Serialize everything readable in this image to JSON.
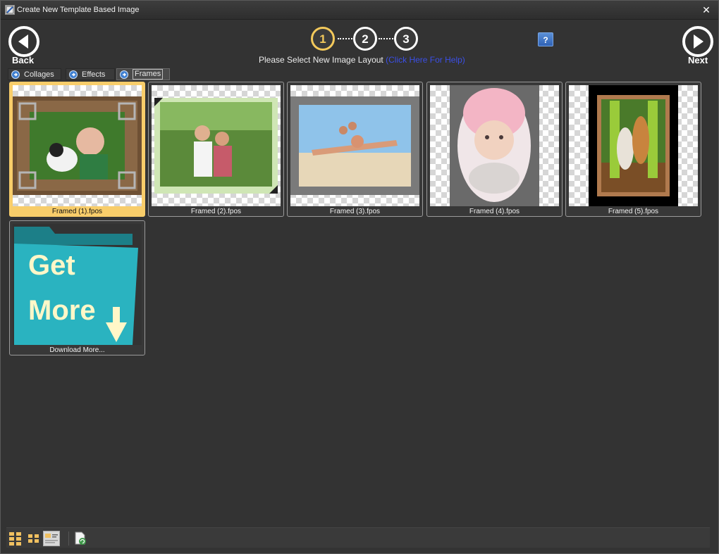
{
  "window": {
    "title": "Create New Template Based Image",
    "close_glyph": "✕"
  },
  "nav": {
    "back_label": "Back",
    "next_label": "Next"
  },
  "steps": [
    {
      "label": "1",
      "state": "active"
    },
    {
      "label": "2",
      "state": "inactive"
    },
    {
      "label": "3",
      "state": "inactive"
    }
  ],
  "instruction": {
    "text": "Please Select New Image Layout ",
    "help_link": "(Click Here For Help)"
  },
  "help_button": {
    "label": "?"
  },
  "tabs": [
    {
      "label": "Collages",
      "selected": false
    },
    {
      "label": "Effects",
      "selected": false
    },
    {
      "label": "Frames",
      "selected": true
    }
  ],
  "templates": [
    {
      "caption": "Framed (1).fpos",
      "selected": true
    },
    {
      "caption": "Framed (2).fpos",
      "selected": false
    },
    {
      "caption": "Framed (3).fpos",
      "selected": false
    },
    {
      "caption": "Framed (4).fpos",
      "selected": false
    },
    {
      "caption": "Framed (5).fpos",
      "selected": false
    }
  ],
  "download_tile": {
    "caption": "Download More...",
    "line1": "Get",
    "line2": "More"
  },
  "colors": {
    "accent": "#f3c95b",
    "selected_tile": "#f8cd6a",
    "link": "#3b4fe6",
    "folder": "#2ab3c0"
  },
  "statusbar": {
    "buttons": [
      "large-icons",
      "medium-icons",
      "details-view",
      "refresh"
    ]
  }
}
